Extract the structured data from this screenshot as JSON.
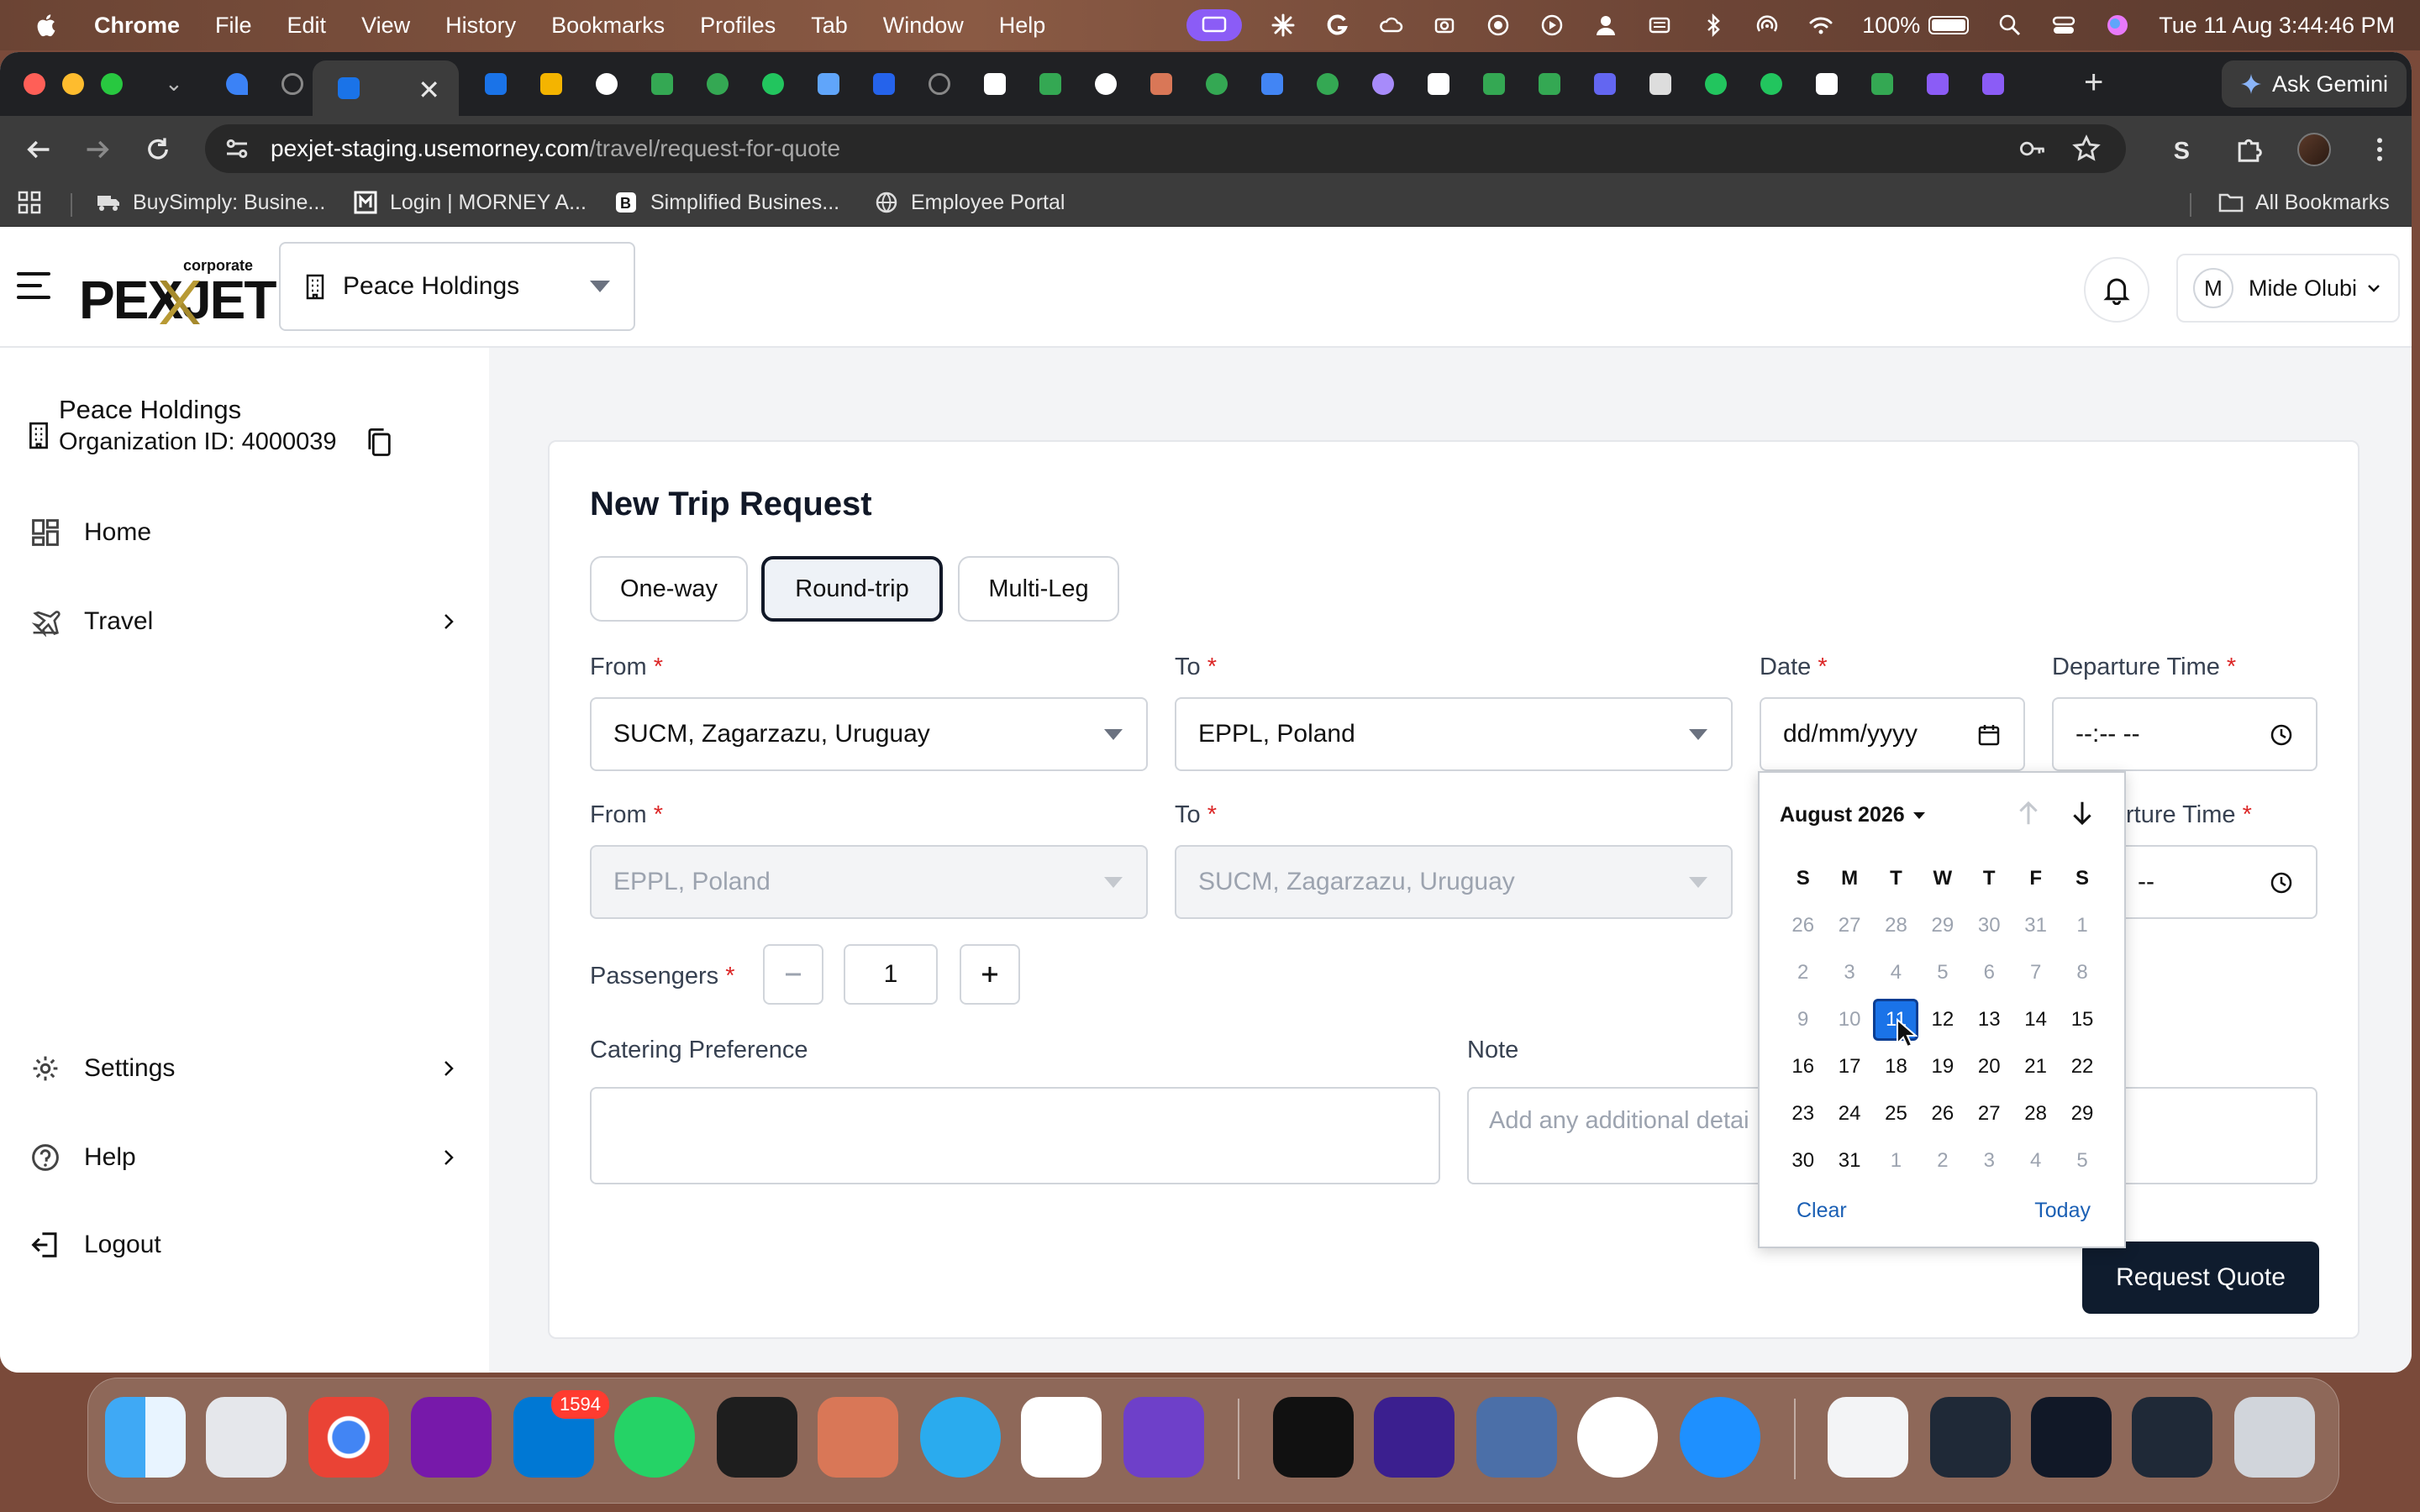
{
  "menubar": {
    "app_name": "Chrome",
    "items": [
      "File",
      "Edit",
      "View",
      "History",
      "Bookmarks",
      "Profiles",
      "Tab",
      "Window",
      "Help"
    ],
    "battery": "100%",
    "battery_level": 1.0,
    "datetime": "Tue 11 Aug  3:44:46 PM"
  },
  "browser": {
    "gemini_label": "Ask Gemini",
    "url_host": "pexjet-staging.usemorney.com",
    "url_path": "/travel/request-for-quote",
    "bookmarks": [
      "BuySimply: Busine...",
      "Login | MORNEY A...",
      "Simplified Busines...",
      "Employee Portal"
    ],
    "all_bookmarks": "All Bookmarks"
  },
  "header": {
    "logo_word": "PEXJET",
    "logo_tag": "corporate",
    "org_name": "Peace Holdings",
    "user_initial": "M",
    "user_name": "Mide Olubi"
  },
  "sidebar": {
    "org_name": "Peace Holdings",
    "org_id": "Organization ID: 4000039",
    "items": [
      {
        "label": "Home"
      },
      {
        "label": "Travel"
      },
      {
        "label": "Settings"
      },
      {
        "label": "Help"
      },
      {
        "label": "Logout"
      }
    ]
  },
  "form": {
    "title": "New Trip Request",
    "trip_types": [
      "One-way",
      "Round-trip",
      "Multi-Leg"
    ],
    "selected_trip_type": "Round-trip",
    "from_label": "From",
    "to_label": "To",
    "date_label": "Date",
    "departure_label": "Departure Time",
    "departure_label_partial": "rture Time",
    "required_mark": "*",
    "leg1_from": "SUCM, Zagarzazu, Uruguay",
    "leg1_to": "EPPL, Poland",
    "date_placeholder": "dd/mm/yyyy",
    "time_placeholder": "--:-- --",
    "leg2_from": "EPPL, Poland",
    "leg2_to": "SUCM, Zagarzazu, Uruguay",
    "leg2_time_partial": "--",
    "passengers_label": "Passengers",
    "passengers": "1",
    "catering_label": "Catering Preference",
    "note_label": "Note",
    "note_placeholder": "Add any additional detai",
    "submit": "Request Quote"
  },
  "datepicker": {
    "month": "August 2026",
    "weekdays": [
      "S",
      "M",
      "T",
      "W",
      "T",
      "F",
      "S"
    ],
    "weeks": [
      [
        "26",
        "27",
        "28",
        "29",
        "30",
        "31",
        "1"
      ],
      [
        "2",
        "3",
        "4",
        "5",
        "6",
        "7",
        "8"
      ],
      [
        "9",
        "10",
        "11",
        "12",
        "13",
        "14",
        "15"
      ],
      [
        "16",
        "17",
        "18",
        "19",
        "20",
        "21",
        "22"
      ],
      [
        "23",
        "24",
        "25",
        "26",
        "27",
        "28",
        "29"
      ],
      [
        "30",
        "31",
        "1",
        "2",
        "3",
        "4",
        "5"
      ]
    ],
    "selected": "11",
    "clear": "Clear",
    "today": "Today"
  },
  "dock": {
    "mail_badge": "1594"
  }
}
